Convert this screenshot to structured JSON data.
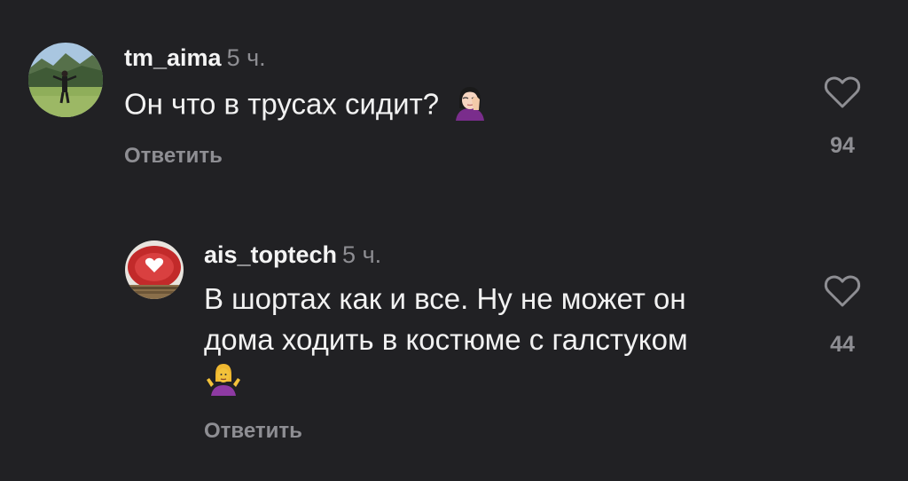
{
  "comments": [
    {
      "username": "tm_aima",
      "time": "5 ч.",
      "text": "Он что в трусах сидит?",
      "emoji": "face-palm-woman-emoji",
      "reply_label": "Ответить",
      "likes": "94",
      "like_icon": "heart-outline-icon"
    },
    {
      "username": "ais_toptech",
      "time": "5 ч.",
      "text_line1": "В шортах как и все. Ну не может он",
      "text_line2": "дома ходить в костюме с галстуком",
      "emoji": "shrug-woman-emoji",
      "reply_label": "Ответить",
      "likes": "44",
      "like_icon": "heart-outline-icon"
    }
  ],
  "colors": {
    "background": "#212124",
    "primary_text": "#f2f2f2",
    "secondary_text": "#8e8e93"
  }
}
